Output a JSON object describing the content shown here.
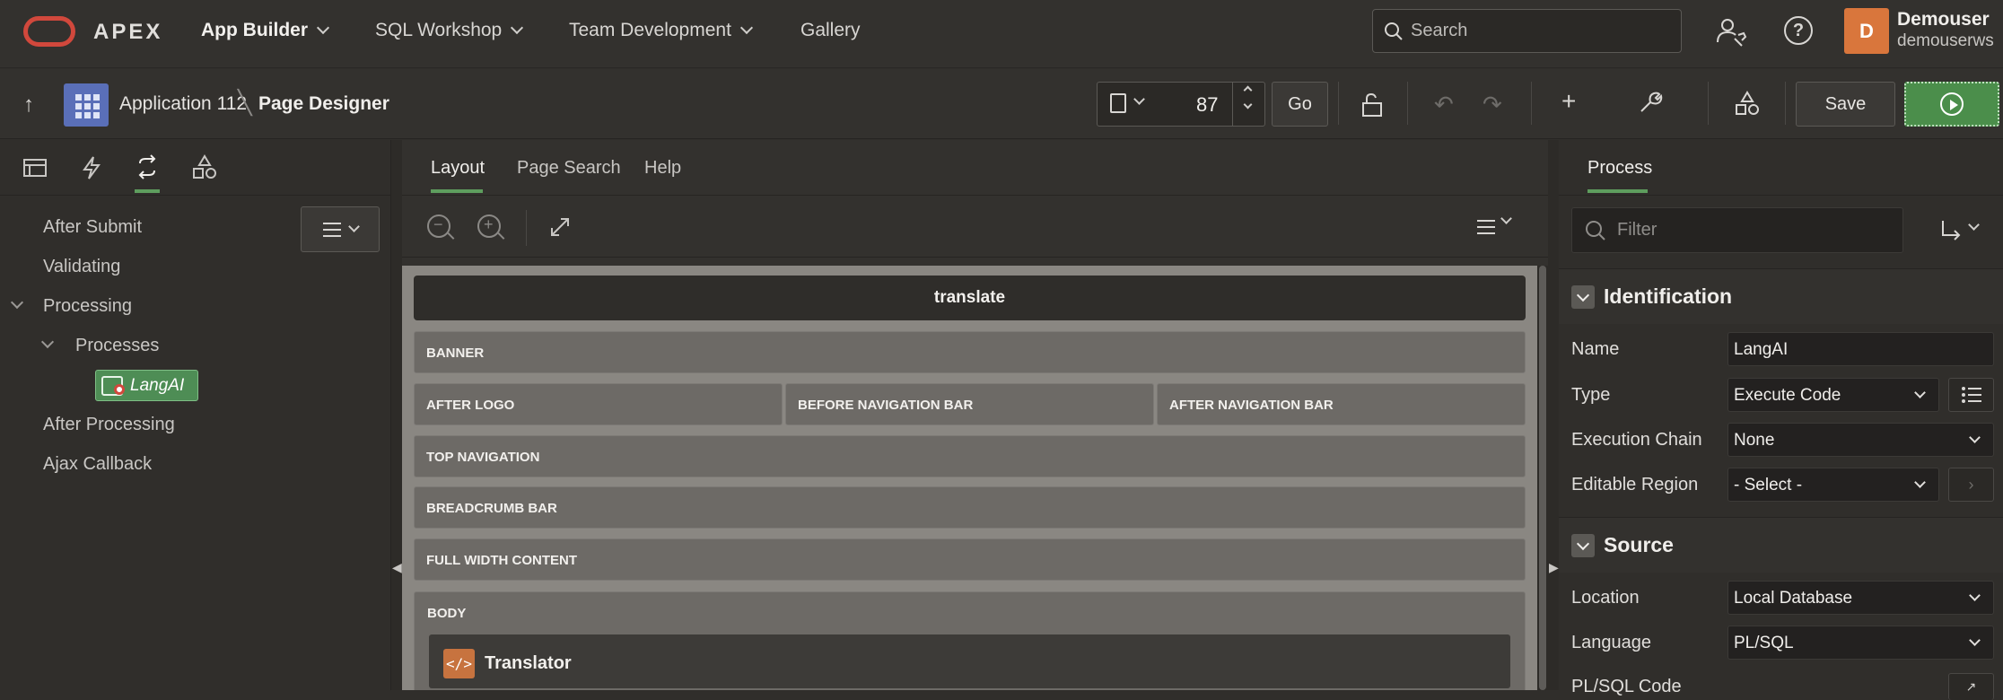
{
  "top_nav": {
    "brand": "APEX",
    "menu": [
      {
        "label": "App Builder"
      },
      {
        "label": "SQL Workshop"
      },
      {
        "label": "Team Development"
      },
      {
        "label": "Gallery"
      }
    ],
    "search_placeholder": "Search",
    "help_icon": "?",
    "avatar_initial": "D",
    "user_name": "Demouser",
    "workspace": "demouserws"
  },
  "toolbar": {
    "app_label": "Application 112",
    "page_label": "Page Designer",
    "page_number": "87",
    "go_label": "Go",
    "save_label": "Save"
  },
  "left_pane": {
    "tree": {
      "after_submit": "After Submit",
      "validating": "Validating",
      "processing": "Processing",
      "processes": "Processes",
      "langai": "LangAI",
      "after_processing": "After Processing",
      "ajax_callback": "Ajax Callback"
    }
  },
  "center": {
    "tabs": [
      {
        "label": "Layout"
      },
      {
        "label": "Page Search"
      },
      {
        "label": "Help"
      }
    ],
    "page_title": "translate",
    "regions": {
      "banner": "BANNER",
      "after_logo": "AFTER LOGO",
      "before_nav_bar": "BEFORE NAVIGATION BAR",
      "after_nav_bar": "AFTER NAVIGATION BAR",
      "top_navigation": "TOP NAVIGATION",
      "breadcrumb_bar": "BREADCRUMB BAR",
      "full_width_content": "FULL WIDTH CONTENT",
      "body": "BODY"
    },
    "translator_region": "Translator"
  },
  "right_pane": {
    "tab": "Process",
    "filter_placeholder": "Filter",
    "identification": {
      "title": "Identification",
      "name_label": "Name",
      "name_value": "LangAI",
      "type_label": "Type",
      "type_value": "Execute Code",
      "chain_label": "Execution Chain",
      "chain_value": "None",
      "editable_label": "Editable Region",
      "editable_value": "- Select -"
    },
    "source": {
      "title": "Source",
      "location_label": "Location",
      "location_value": "Local Database",
      "language_label": "Language",
      "language_value": "PL/SQL",
      "code_label": "PL/SQL Code"
    }
  }
}
